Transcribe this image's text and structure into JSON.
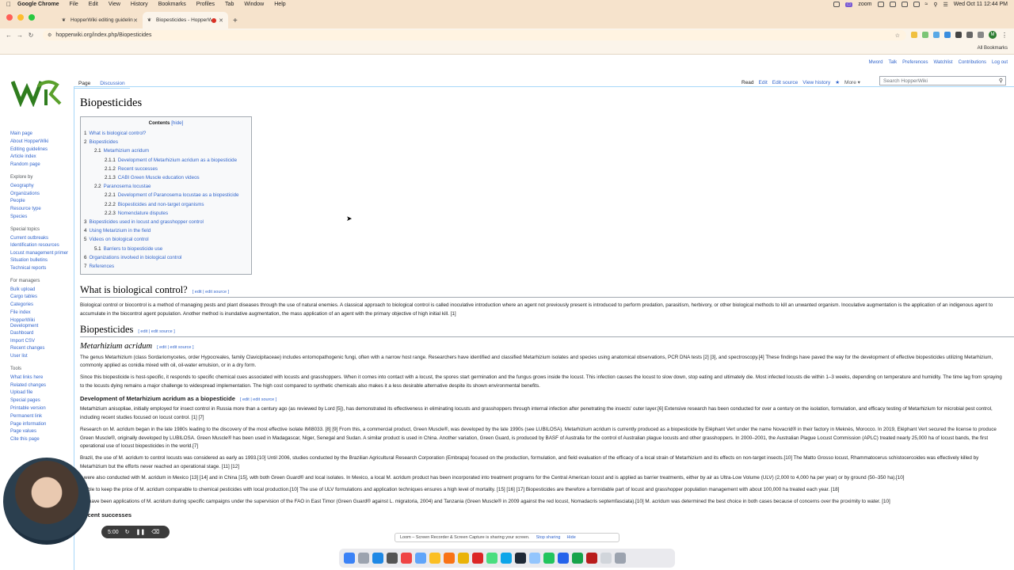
{
  "menubar": {
    "app": "Google Chrome",
    "items": [
      "File",
      "Edit",
      "View",
      "History",
      "Bookmarks",
      "Profiles",
      "Tab",
      "Window",
      "Help"
    ],
    "zoom_label": "zoom",
    "datetime": "Wed Oct 11  12:44 PM"
  },
  "tabs": [
    {
      "title": "HopperWiki editing guidelines",
      "active": false
    },
    {
      "title": "Biopesticides - HopperWiki",
      "active": true
    }
  ],
  "address": {
    "url": "hopperwiki.org/index.php/Biopesticides"
  },
  "bookmarks": {
    "all": "All Bookmarks"
  },
  "personal": [
    "Mword",
    "Talk",
    "Preferences",
    "Watchlist",
    "Contributions",
    "Log out"
  ],
  "page_tabs": {
    "page": "Page",
    "discussion": "Discussion"
  },
  "view_tabs": {
    "read": "Read",
    "edit": "Edit",
    "edit_source": "Edit source",
    "history": "View history",
    "more": "More"
  },
  "search": {
    "placeholder": "Search HopperWiki"
  },
  "sidebar": {
    "main": [
      "Main page",
      "About HopperWiki",
      "Editing guidelines",
      "Article index",
      "Random page"
    ],
    "explore_heading": "Explore by",
    "explore": [
      "Geography",
      "Organizations",
      "People",
      "Resource type",
      "Species"
    ],
    "special_heading": "Special topics",
    "special": [
      "Current outbreaks",
      "Identification resources",
      "Locust management primer",
      "Situation bulletins",
      "Technical reports"
    ],
    "managers_heading": "For managers",
    "managers": [
      "Bulk upload",
      "Cargo tables",
      "Categories",
      "File index",
      "HopperWiki Development",
      "Dashboard",
      "Import CSV",
      "Recent changes",
      "User list"
    ],
    "tools_heading": "Tools",
    "tools": [
      "What links here",
      "Related changes",
      "Upload file",
      "Special pages",
      "Printable version",
      "Permanent link",
      "Page information",
      "Page values",
      "Cite this page"
    ]
  },
  "article": {
    "title": "Biopesticides",
    "toc_title": "Contents",
    "toc_hide": "[hide]",
    "toc": [
      {
        "num": "1",
        "text": "What is biological control?",
        "lvl": 0
      },
      {
        "num": "2",
        "text": "Biopesticides",
        "lvl": 0
      },
      {
        "num": "2.1",
        "text": "Metarhizium acridum",
        "lvl": 1
      },
      {
        "num": "2.1.1",
        "text": "Development of Metarhizium acridum as a biopesticide",
        "lvl": 2
      },
      {
        "num": "2.1.2",
        "text": "Recent successes",
        "lvl": 2
      },
      {
        "num": "2.1.3",
        "text": "CABI Green Muscle education videos",
        "lvl": 2
      },
      {
        "num": "2.2",
        "text": "Paranosema locustae",
        "lvl": 1
      },
      {
        "num": "2.2.1",
        "text": "Development of Paranosema locustae as a biopesticide",
        "lvl": 2
      },
      {
        "num": "2.2.2",
        "text": "Biopesticides and non-target organisms",
        "lvl": 2
      },
      {
        "num": "2.2.3",
        "text": "Nomenclature disputes",
        "lvl": 2
      },
      {
        "num": "3",
        "text": "Biopesticides used in locust and grasshopper control",
        "lvl": 0
      },
      {
        "num": "4",
        "text": "Using Metarizium in the field",
        "lvl": 0
      },
      {
        "num": "5",
        "text": "Videos on biological control",
        "lvl": 0
      },
      {
        "num": "5.1",
        "text": "Barriers to biopesticide use",
        "lvl": 1
      },
      {
        "num": "6",
        "text": "Organizations involved in biological control",
        "lvl": 0
      },
      {
        "num": "7",
        "text": "References",
        "lvl": 0
      }
    ],
    "edit_label": "[ edit | edit source ]",
    "h_biocontrol": "What is biological control?",
    "p_biocontrol": "Biological control or biocontrol is a method of managing pests and plant diseases through the use of natural enemies. A classical approach to biological control is called inoculative introduction where an agent not previously present is introduced to perform predation, parasitism, herbivory, or other biological methods to kill an unwanted organism. Inoculative augmentation is the application of an indigenous agent to accumulate in the biocontrol agent population. Another method is inundative augmentation, the mass application of an agent with the primary objective of high initial kill. [1]",
    "h_biopesticides": "Biopesticides",
    "h_metarhizium": "Metarhizium acridum",
    "p_meta1": "The genus Metarhizium (class Sordariomycetes, order Hypocreales, family Clavicipitaceae) includes entomopathogenic fungi, often with a narrow host range. Researchers have identified and classified Metarhizium isolates and species using anatomical observations, PCR DNA tests [2] [3], and spectroscopy.[4] These findings have paved the way for the development of effective biopesticides utilizing Metarhizium, commonly applied as conidia mixed with oil, oil-water emulsion, or in a dry form.",
    "p_meta2": "Since this biopesticide is host-specific, it responds to specific chemical cues associated with locusts and grasshoppers. When it comes into contact with a locust, the spores start germination and the fungus grows inside the locust. This infection causes the locust to slow down, stop eating and ultimately die. Most infected locusts die within 1–3 weeks, depending on temperature and humidity. The time lag from spraying to the locusts dying remains a major challenge to widespread implementation. The high cost compared to synthetic chemicals also makes it a less desirable alternative despite its shown environmental benefits.",
    "h_dev": "Development of Metarhizium acridum as a biopesticide",
    "p_dev1": "Metarhizium anisopliae, initially employed for insect control in Russia more than a century ago (as reviewed by Lord [5]), has demonstrated its effectiveness in eliminating locusts and grasshoppers through internal infection after penetrating the insects' outer layer.[6] Extensive research has been conducted for over a century on the isolation, formulation, and efficacy testing of Metarhizium for microbial pest control, including recent studies focused on locust control. [1] [7]",
    "p_dev2": "Research on M. acridum began in the late 1980s leading to the discovery of the most effective isolate IMI8033. [8] [9] From this, a commercial product, Green Muscle®, was developed by the late 1990s (see LUBILOSA). Metarhizium acridum is currently produced as a biopesticide by Eléphant Vert under the name Novacrid® in their factory in Meknès, Morocco. In 2019, Eléphant Vert secured the license to produce Green Muscle®, originally developed by LUBILOSA. Green Muscle® has been used in Madagascar, Niger, Senegal and Sudan. A similar product is used in China. Another variation, Green Guard, is produced by BASF of Australia for the control of Australian plague locusts and other grasshoppers. In 2000–2001, the Australian Plague Locust Commission (APLC) treated nearly 25,000 ha of locust bands, the first operational use of locust biopesticides in the world.[7]",
    "p_dev3": "Brazil, the use of M. acridum to control locusts was considered as early as 1993.[10] Until 2006, studies conducted by the Brazilian Agricultural Research Corporation (Embrapa) focused on the production, formulation, and field evaluation of the efficacy of a local strain of Metarhizium and its effects on non-target insects.[10] The Matto Grosso locust, Rhammatocerus schistocercoides was effectively killed by Metarhizium but the efforts never reached an operational stage. [11] [12]",
    "p_dev4": "s were also conducted with M. acridum in Mexico [13] [14] and in China [15], with both Green Guard® and local isolates. In Mexico, a local M. acridum product has been incorporated into treatment programs for the Central American locust and is applied as barrier treatments, either by air as Ultra-Low Volume (ULV) (2,000 to 4,000 ha per year) or by ground (50–350 ha).[10]",
    "p_dev5": "is able to keep the price of M. acridum comparable to chemical pesticides with local production.[10] The use of ULV formulations and application techniques ensures a high level of mortality. [15] [16] [17] Biopesticides are therefore a formidable part of locust and grasshopper population management with about 100,000 ha treated each year. [18]",
    "p_dev6": "ere have been applications of M. acridum during specific campaigns under the supervision of the FAO in East Timor (Green Guard® against L. migratoria, 2004) and Tanzania (Green Muscle® in 2009 against the red locust, Nomadacris septemfasciata).[10] M. acridum was determined the best choice in both cases because of concerns over the proximity to water. [10]",
    "h_recent": "Recent successes"
  },
  "overlay": {
    "timer": "5:00",
    "loom_msg": "Loom – Screen Recorder & Screen Capture is sharing your screen.",
    "loom_stop": "Stop sharing",
    "loom_hide": "Hide"
  }
}
